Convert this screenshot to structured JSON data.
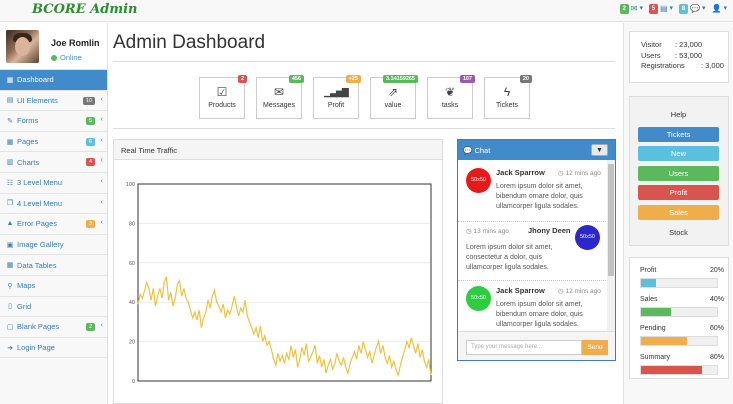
{
  "app": {
    "brand": "BCORE Admin"
  },
  "topnav": [
    {
      "badge": "2",
      "badge_color": "#5cb85c",
      "icon": "envelope-icon",
      "glyph": "✉"
    },
    {
      "badge": "5",
      "badge_color": "#d9534f",
      "icon": "tasks-icon",
      "glyph": "▤"
    },
    {
      "badge": "8",
      "badge_color": "#5bc0de",
      "icon": "comments-icon",
      "glyph": "💬"
    },
    {
      "badge": "",
      "badge_color": "",
      "icon": "user-icon",
      "glyph": "👤"
    }
  ],
  "profile": {
    "name": "Joe Romlin",
    "status": "Online"
  },
  "sidebar": {
    "items": [
      {
        "label": "Dashboard",
        "icon": "table-icon",
        "glyph": "▦",
        "active": true
      },
      {
        "label": "UI Elements",
        "icon": "tasks-icon",
        "glyph": "▤",
        "badge": "10",
        "badge_color": "#777777",
        "caret": true
      },
      {
        "label": "Forms",
        "icon": "pencil-icon",
        "glyph": "✎",
        "badge": "5",
        "badge_color": "#5cb85c",
        "caret": true
      },
      {
        "label": "Pages",
        "icon": "table-icon",
        "glyph": "▦",
        "badge": "6",
        "badge_color": "#5bc0de",
        "caret": true
      },
      {
        "label": "Charts",
        "icon": "bar-chart-icon",
        "glyph": "▥",
        "badge": "4",
        "badge_color": "#d9534f",
        "caret": true
      },
      {
        "label": "3 Level Menu",
        "icon": "sitemap-icon",
        "glyph": "☷",
        "caret": true
      },
      {
        "label": "4 Level Menu",
        "icon": "folder-icon",
        "glyph": "❐",
        "caret": true
      },
      {
        "label": "Error Pages",
        "icon": "warning-icon",
        "glyph": "▲",
        "badge": "3",
        "badge_color": "#f0ad4e",
        "caret": true
      },
      {
        "label": "Image Gallery",
        "icon": "film-icon",
        "glyph": "▣",
        "caret": false
      },
      {
        "label": "Data Tables",
        "icon": "table-icon",
        "glyph": "▦",
        "caret": false
      },
      {
        "label": "Maps",
        "icon": "map-marker-icon",
        "glyph": "⚲",
        "caret": false
      },
      {
        "label": "Grid",
        "icon": "columns-icon",
        "glyph": "▯",
        "caret": false
      },
      {
        "label": "Blank Pages",
        "icon": "file-icon",
        "glyph": "▢",
        "badge": "2",
        "badge_color": "#5cb85c",
        "caret": true
      },
      {
        "label": "Login Page",
        "icon": "sign-in-icon",
        "glyph": "➜",
        "caret": false
      }
    ]
  },
  "page": {
    "title": "Admin Dashboard"
  },
  "tiles": [
    {
      "label": "Products",
      "badge": "2",
      "badge_color": "#d9534f",
      "icon": "check-square-icon",
      "glyph": "☑"
    },
    {
      "label": "Messages",
      "badge": "456",
      "badge_color": "#5cb85c",
      "icon": "envelope-icon",
      "glyph": "✉"
    },
    {
      "label": "Profit",
      "badge": "+25",
      "badge_color": "#f0ad4e",
      "icon": "signal-icon",
      "glyph": "▁▃▅▇"
    },
    {
      "label": "value",
      "badge": "3.14159265",
      "badge_color": "#5cb85c",
      "icon": "external-link-icon",
      "glyph": "⇗"
    },
    {
      "label": "tasks",
      "badge": "107",
      "badge_color": "#9b59b6",
      "icon": "leaf-icon",
      "glyph": "❦"
    },
    {
      "label": "Tickets",
      "badge": "20",
      "badge_color": "#777777",
      "icon": "bolt-icon",
      "glyph": "ϟ"
    }
  ],
  "traffic": {
    "title": "Real Time Traffic"
  },
  "chart_data": {
    "type": "line",
    "title": "Real Time Traffic",
    "xlabel": "",
    "ylabel": "",
    "ylim": [
      0,
      100
    ],
    "yticks": [
      0,
      20,
      40,
      60,
      80,
      100
    ],
    "grid": true,
    "series": [
      {
        "color": "#edc240",
        "values": [
          39,
          44,
          42,
          46,
          50,
          47,
          41,
          47,
          38,
          43,
          47,
          42,
          50,
          53,
          41,
          45,
          38,
          42,
          49,
          51,
          43,
          47,
          42,
          40,
          36,
          32,
          35,
          31,
          36,
          27,
          32,
          35,
          41,
          37,
          43,
          46,
          40,
          38,
          35,
          39,
          32,
          36,
          34,
          38,
          43,
          38,
          33,
          37,
          35,
          41,
          33,
          30,
          27,
          24,
          27,
          22,
          28,
          20,
          23,
          18,
          20,
          16,
          11,
          8,
          14,
          10,
          13,
          9,
          14,
          11,
          18,
          12,
          16,
          7,
          11,
          17,
          13,
          19,
          10,
          12,
          15,
          18,
          9,
          13,
          7,
          11,
          4,
          8,
          11,
          6,
          9,
          14,
          10,
          8,
          12,
          7,
          4,
          9,
          12,
          15,
          11,
          18,
          14,
          20,
          16,
          12,
          15,
          9,
          13,
          17,
          20,
          14,
          18,
          12,
          9,
          13,
          7,
          10,
          6,
          3,
          8,
          12,
          16,
          20,
          17,
          22,
          18,
          14,
          19,
          12,
          16,
          10,
          7,
          11,
          3
        ]
      }
    ]
  },
  "chat": {
    "title": "Chat",
    "messages": [
      {
        "name": "Jack Sparrow",
        "time": "12 mins ago",
        "text": "Lorem ipsum dolor sit amet, bibendum ornare dolor, quis ullamcorper ligula sodales.",
        "avatar": "50x50",
        "avatar_color": "#e31b1b",
        "side": "left"
      },
      {
        "name": "Jhony Deen",
        "time": "13 mins ago",
        "text": "Lorem ipsum dolor sit amet, consectetur a dolor, quis ullamcorper ligula sodales.",
        "avatar": "50x50",
        "avatar_color": "#2b27c9",
        "side": "right"
      },
      {
        "name": "Jack Sparrow",
        "time": "12 mins ago",
        "text": "Lorem ipsum dolor sit amet, bibendum ornare dolor, quis ullamcorper ligula sodales.",
        "avatar": "50x50",
        "avatar_color": "#2ecc40",
        "side": "left"
      }
    ],
    "input_placeholder": "Type your message here...",
    "send_label": "Send"
  },
  "stats": [
    {
      "label": "Visitor",
      "value": ": 23,000"
    },
    {
      "label": "Users",
      "value": ": 53,000"
    },
    {
      "label": "Registrations",
      "value": ": 3,000"
    }
  ],
  "quick_buttons": [
    {
      "label": "Help",
      "color": ""
    },
    {
      "label": "Tickets",
      "color": "#428bca"
    },
    {
      "label": "New",
      "color": "#5bc0de"
    },
    {
      "label": "Users",
      "color": "#5cb85c"
    },
    {
      "label": "Profit",
      "color": "#d9534f"
    },
    {
      "label": "Sales",
      "color": "#f0ad4e"
    },
    {
      "label": "Stock",
      "color": ""
    }
  ],
  "progress": [
    {
      "label": "Profit",
      "percent": "20%",
      "value": 0.2,
      "color": "#5bc0de"
    },
    {
      "label": "Sales",
      "percent": "40%",
      "value": 0.4,
      "color": "#5cb85c"
    },
    {
      "label": "Pending",
      "percent": "60%",
      "value": 0.6,
      "color": "#f0ad4e"
    },
    {
      "label": "Summary",
      "percent": "80%",
      "value": 0.8,
      "color": "#d9534f"
    }
  ]
}
